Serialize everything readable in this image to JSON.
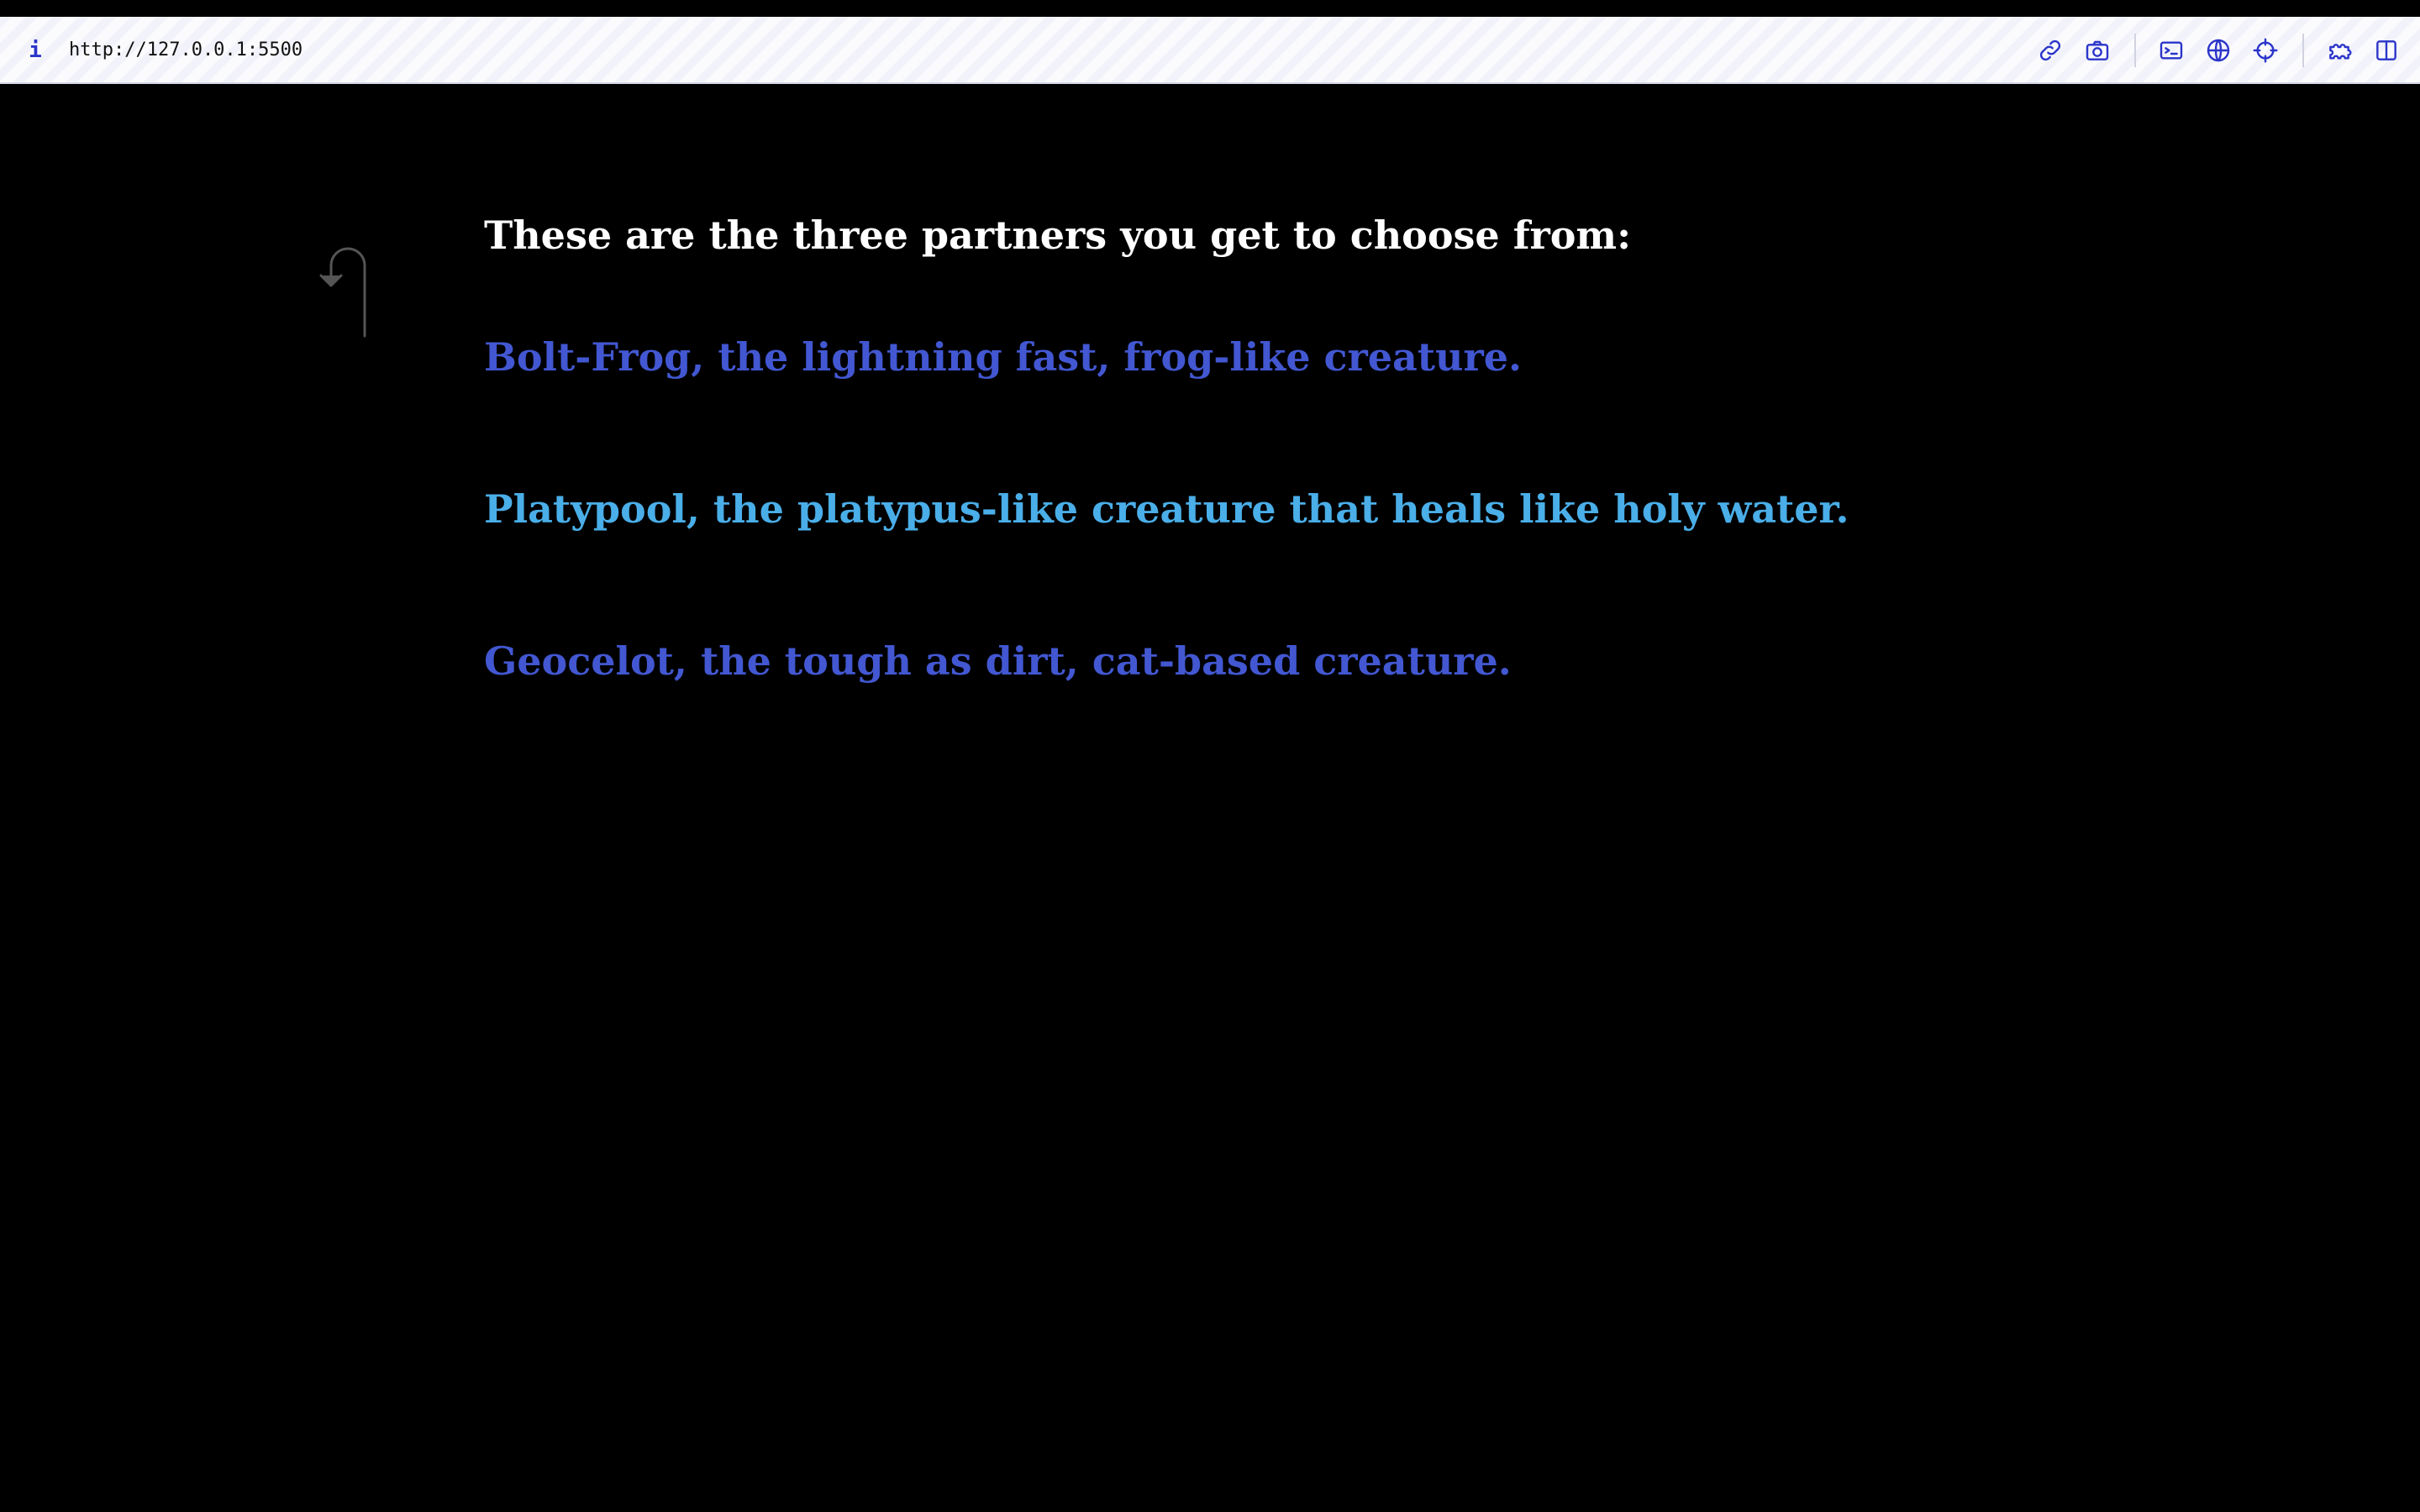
{
  "browser": {
    "info_glyph": "i",
    "url": "http://127.0.0.1:5500",
    "accent_color": "#2b35c9",
    "tools": [
      "link-icon",
      "camera-icon",
      "terminal-icon",
      "globe-icon",
      "crosshair-icon",
      "extensions-icon",
      "split-view-icon"
    ]
  },
  "page": {
    "heading": "These are the three partners you get to choose from:",
    "back_icon": "back-hook-arrow-icon",
    "partners": [
      {
        "label": "Bolt-Frog, the lightning fast, frog-like creature.",
        "color": "#4257d1"
      },
      {
        "label": "Platypool, the platypus-like creature that heals like holy water.",
        "color": "#4aaee8"
      },
      {
        "label": "Geocelot, the tough as dirt, cat-based creature.",
        "color": "#4257d1"
      }
    ]
  }
}
